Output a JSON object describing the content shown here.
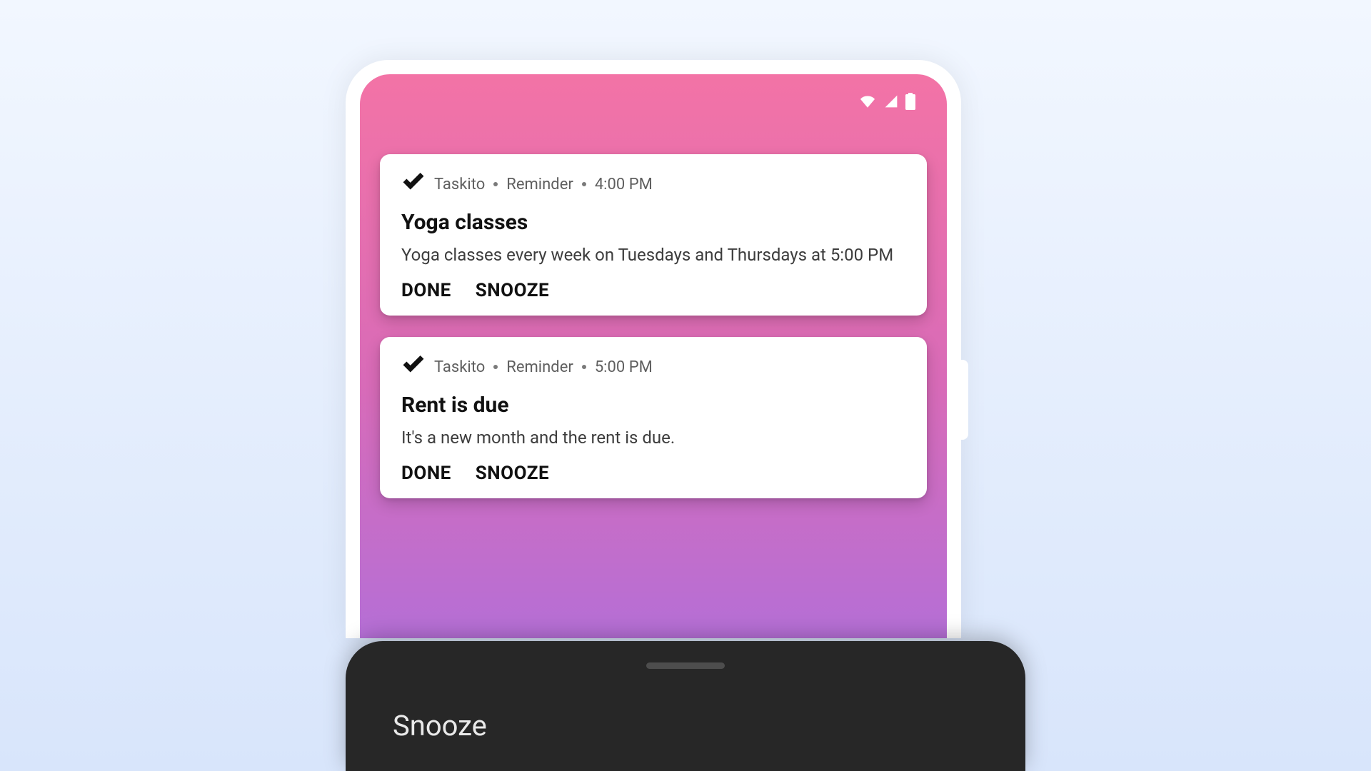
{
  "notifications": [
    {
      "app": "Taskito",
      "category": "Reminder",
      "time": "4:00 PM",
      "title": "Yoga classes",
      "body": "Yoga classes every week on Tuesdays and Thursdays at 5:00 PM",
      "action_done": "DONE",
      "action_snooze": "SNOOZE"
    },
    {
      "app": "Taskito",
      "category": "Reminder",
      "time": "5:00 PM",
      "title": "Rent is due",
      "body": "It's a new month and the rent is due.",
      "action_done": "DONE",
      "action_snooze": "SNOOZE"
    }
  ],
  "sheet": {
    "title": "Snooze"
  }
}
